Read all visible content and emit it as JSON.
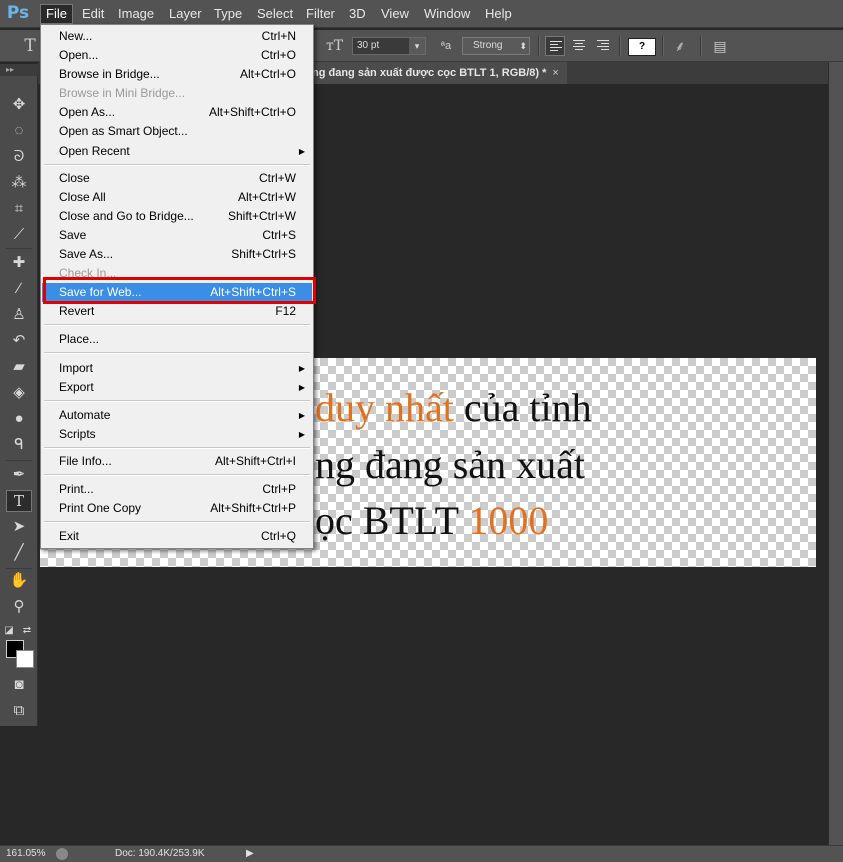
{
  "app": {
    "logo": "Ps"
  },
  "menubar": {
    "items": [
      "File",
      "Edit",
      "Image",
      "Layer",
      "Type",
      "Select",
      "Filter",
      "3D",
      "View",
      "Window",
      "Help"
    ]
  },
  "options": {
    "font_size": "30 pt",
    "antialias": "Strong",
    "swatch_label": "?"
  },
  "document_tab": {
    "title": "ng đang sản xuất được cọc BTLT 1, RGB/8) *",
    "close": "×"
  },
  "canvas_text": {
    "line1_orange": "duy nhất",
    "line1_rest": " của tỉnh",
    "line2": "ng đang sản xuất",
    "line3_prefix": "ọc BTLT ",
    "line3_orange": "1000"
  },
  "file_menu": [
    {
      "label": "New...",
      "shortcut": "Ctrl+N"
    },
    {
      "label": "Open...",
      "shortcut": "Ctrl+O"
    },
    {
      "label": "Browse in Bridge...",
      "shortcut": "Alt+Ctrl+O"
    },
    {
      "label": "Browse in Mini Bridge...",
      "shortcut": "",
      "disabled": true
    },
    {
      "label": "Open As...",
      "shortcut": "Alt+Shift+Ctrl+O"
    },
    {
      "label": "Open as Smart Object...",
      "shortcut": ""
    },
    {
      "label": "Open Recent",
      "shortcut": "",
      "submenu": true
    },
    {
      "label": "Close",
      "shortcut": "Ctrl+W"
    },
    {
      "label": "Close All",
      "shortcut": "Alt+Ctrl+W"
    },
    {
      "label": "Close and Go to Bridge...",
      "shortcut": "Shift+Ctrl+W"
    },
    {
      "label": "Save",
      "shortcut": "Ctrl+S"
    },
    {
      "label": "Save As...",
      "shortcut": "Shift+Ctrl+S"
    },
    {
      "label": "Check In...",
      "shortcut": "",
      "disabled": true
    },
    {
      "label": "Save for Web...",
      "shortcut": "Alt+Shift+Ctrl+S",
      "highlighted": true
    },
    {
      "label": "Revert",
      "shortcut": "F12"
    },
    {
      "label": "Place...",
      "shortcut": ""
    },
    {
      "label": "Import",
      "shortcut": "",
      "submenu": true
    },
    {
      "label": "Export",
      "shortcut": "",
      "submenu": true
    },
    {
      "label": "Automate",
      "shortcut": "",
      "submenu": true
    },
    {
      "label": "Scripts",
      "shortcut": "",
      "submenu": true
    },
    {
      "label": "File Info...",
      "shortcut": "Alt+Shift+Ctrl+I"
    },
    {
      "label": "Print...",
      "shortcut": "Ctrl+P"
    },
    {
      "label": "Print One Copy",
      "shortcut": "Alt+Shift+Ctrl+P"
    },
    {
      "label": "Exit",
      "shortcut": "Ctrl+Q"
    }
  ],
  "status": {
    "zoom": "161.05%",
    "doc": "Doc: 190.4K/253.9K"
  },
  "tools": [
    "move-tool",
    "marquee-tool",
    "lasso-tool",
    "magic-wand-tool",
    "crop-tool",
    "eyedropper-tool",
    "healing-brush-tool",
    "brush-tool",
    "clone-stamp-tool",
    "history-brush-tool",
    "eraser-tool",
    "paint-bucket-tool",
    "blur-tool",
    "dodge-tool",
    "pen-tool",
    "type-tool",
    "path-selection-tool",
    "line-tool",
    "hand-tool",
    "zoom-tool"
  ],
  "colors": {
    "accent": "#3a8ee6",
    "highlight_box": "#e10000",
    "orange_text": "#e2711d"
  }
}
